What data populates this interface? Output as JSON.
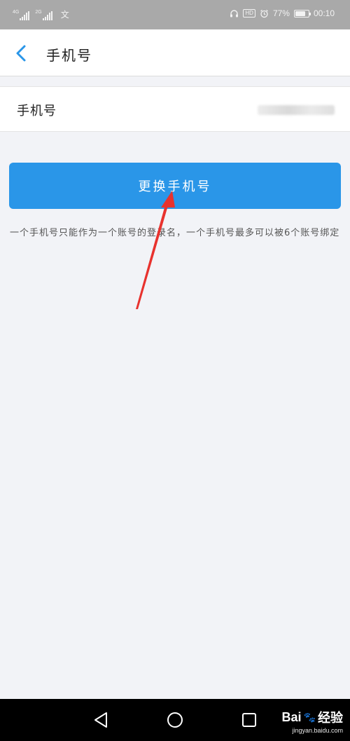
{
  "status_bar": {
    "net1": "4G",
    "net2": "2G",
    "carrier_glyph": "文",
    "battery_level": "77%",
    "time": "00:10",
    "hd": "HD"
  },
  "header": {
    "back_icon": "chevron-left-icon",
    "title": "手机号"
  },
  "phone_row": {
    "label": "手机号",
    "value_state": "blurred"
  },
  "change_button": {
    "label": "更换手机号"
  },
  "note": {
    "text": "一个手机号只能作为一个账号的登录名，一个手机号最多可以被6个账号绑定"
  },
  "annotation": {
    "arrow_color": "#e8322e"
  },
  "nav_bar": {
    "icons": [
      "triangle-back-icon",
      "circle-home-icon",
      "square-recent-icon"
    ]
  },
  "watermark": {
    "brand_a": "Bai",
    "brand_paw": "🐾",
    "brand_b": "经验",
    "domain": "jingyan.baidu.com"
  },
  "colors": {
    "status_bar_bg": "#a9a9a9",
    "accent_blue": "#2a96e8",
    "page_bg": "#f2f3f7",
    "nav_bg": "#000000"
  }
}
